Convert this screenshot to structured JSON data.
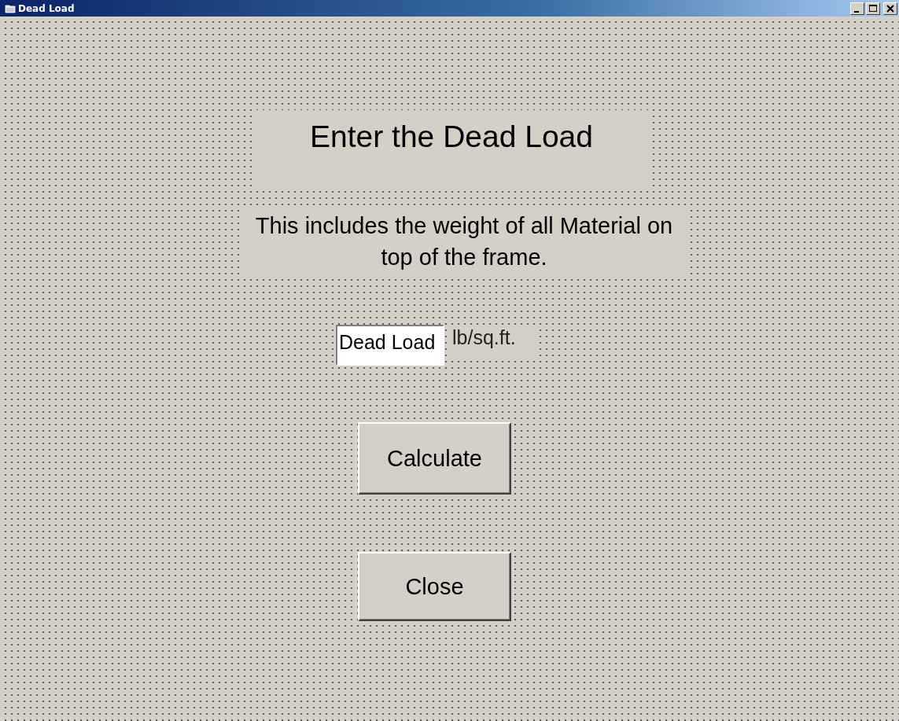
{
  "window": {
    "title": "Dead Load"
  },
  "heading": "Enter the Dead Load",
  "description": "This includes the weight of all Material on top of  the frame.",
  "field": {
    "value": "Dead Load",
    "unit": "lb/sq.ft."
  },
  "buttons": [
    "Calculate",
    "Close"
  ]
}
